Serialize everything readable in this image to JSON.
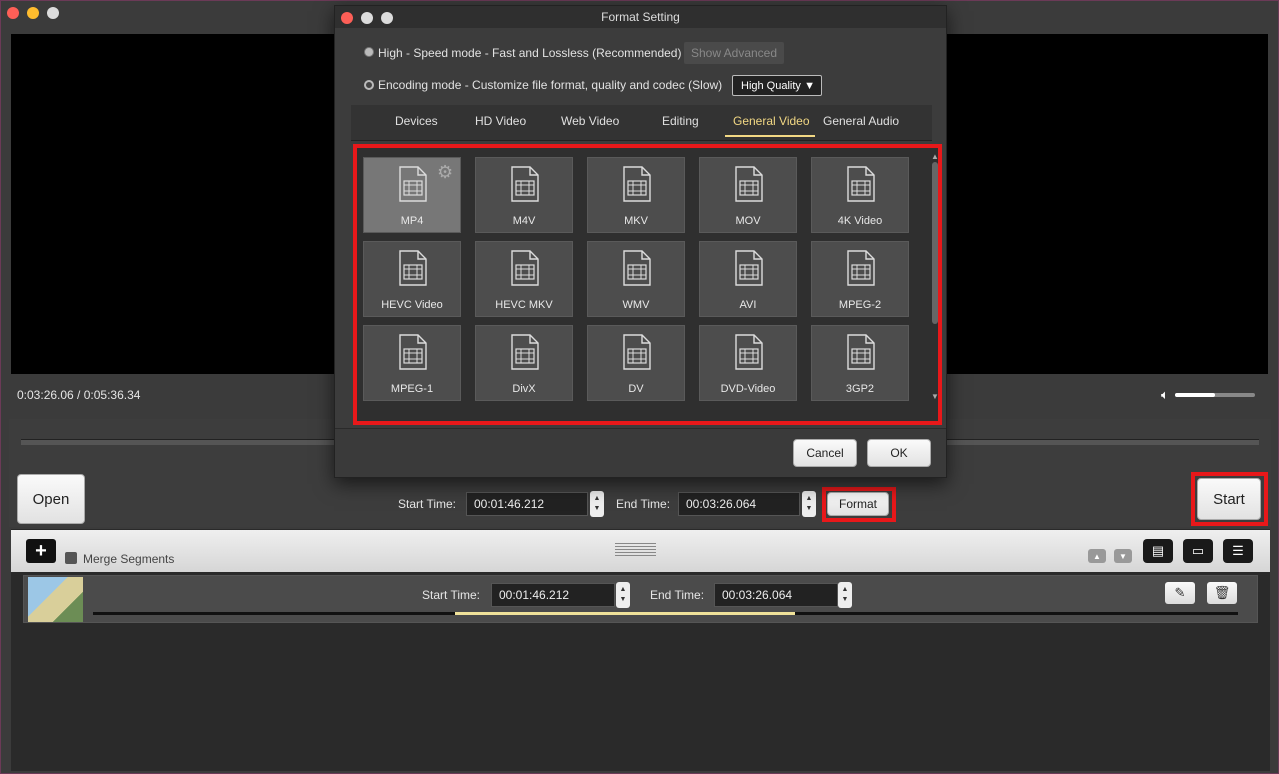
{
  "main": {
    "time_display": "0:03:26.06 / 0:05:36.34",
    "open_label": "Open",
    "start_label": "Start",
    "start_time_label": "Start Time:",
    "start_time_value": "00:01:46.212",
    "end_time_label": "End Time:",
    "end_time_value": "00:03:26.064",
    "format_label": "Format",
    "volume_level": 0.5
  },
  "segments": {
    "merge_label": "Merge Segments",
    "row": {
      "start_time_label": "Start Time:",
      "start_time_value": "00:01:46.212",
      "end_time_label": "End Time:",
      "end_time_value": "00:03:26.064"
    }
  },
  "dialog": {
    "title": "Format Setting",
    "mode_high": "High - Speed mode - Fast and Lossless (Recommended)",
    "show_advanced": "Show Advanced",
    "mode_encoding": "Encoding mode - Customize file format, quality and codec (Slow)",
    "quality": "High Quality",
    "tabs": [
      "Devices",
      "HD Video",
      "Web Video",
      "Editing",
      "General Video",
      "General Audio"
    ],
    "active_tab": "General Video",
    "formats": [
      "MP4",
      "M4V",
      "MKV",
      "MOV",
      "4K Video",
      "HEVC Video",
      "HEVC MKV",
      "WMV",
      "AVI",
      "MPEG-2",
      "MPEG-1",
      "DivX",
      "DV",
      "DVD-Video",
      "3GP2"
    ],
    "selected_format": "MP4",
    "cancel_label": "Cancel",
    "ok_label": "OK"
  },
  "colors": {
    "highlight": "#e8181a",
    "active_tab": "#f2d884"
  }
}
